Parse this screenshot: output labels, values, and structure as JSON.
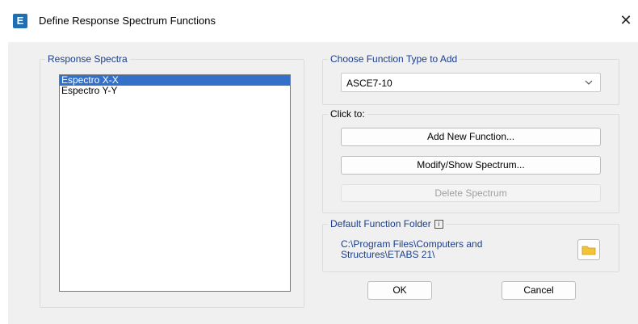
{
  "window": {
    "title": "Define Response Spectrum Functions",
    "app_icon_letter": "E",
    "close_glyph": "✕"
  },
  "response_spectra": {
    "label": "Response Spectra",
    "items": [
      "Espectro X-X",
      "Espectro Y-Y"
    ],
    "selected_index": 0
  },
  "function_type": {
    "label": "Choose Function Type to Add",
    "selected": "ASCE7-10"
  },
  "click_to": {
    "label": "Click to:",
    "add_label": "Add New Function...",
    "modify_label": "Modify/Show Spectrum...",
    "delete_label": "Delete Spectrum"
  },
  "folder": {
    "label": "Default Function Folder",
    "path_line1": "C:\\Program Files\\Computers and",
    "path_line2": "Structures\\ETABS 21\\"
  },
  "footer": {
    "ok_label": "OK",
    "cancel_label": "Cancel"
  },
  "colors": {
    "accent_blue": "#1a3e8c",
    "selection": "#3370c9",
    "folder_yellow": "#f2c335"
  }
}
